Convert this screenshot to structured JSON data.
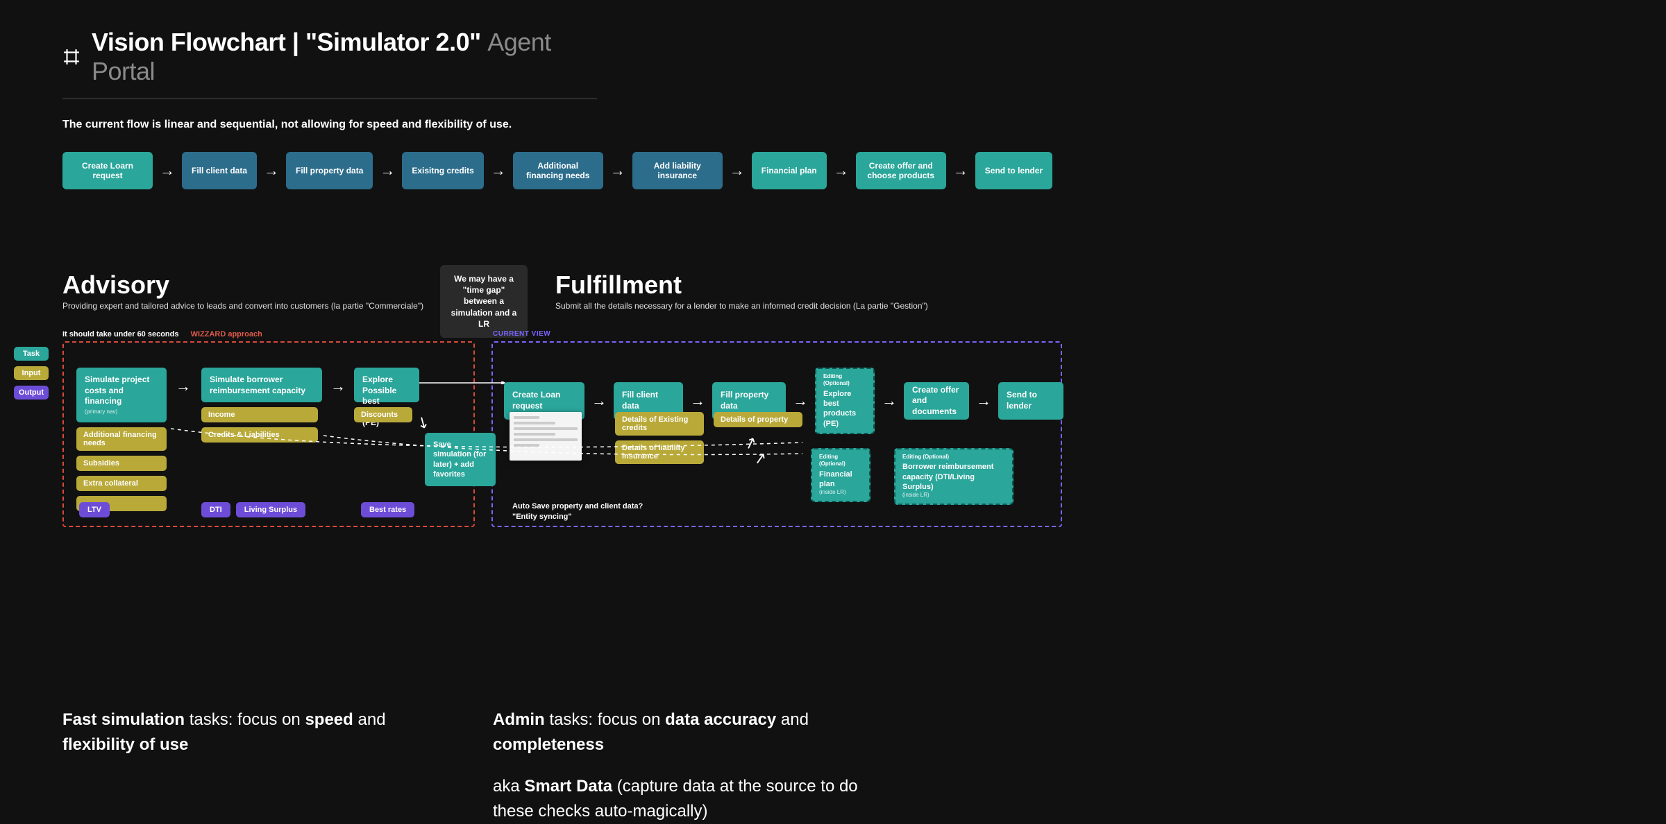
{
  "header": {
    "title_main": "Vision Flowchart | \"Simulator 2.0\"",
    "title_sub": "Agent Portal"
  },
  "intro": "The current flow is linear and sequential, not allowing for speed and flexibility of use.",
  "linear_flow": [
    {
      "label": "Create Loarn request",
      "type": "teal"
    },
    {
      "label": "Fill client data",
      "type": "blue"
    },
    {
      "label": "Fill property data",
      "type": "blue"
    },
    {
      "label": "Exisitng credits",
      "type": "blue"
    },
    {
      "label": "Additional financing needs",
      "type": "blue"
    },
    {
      "label": "Add liability insurance",
      "type": "blue"
    },
    {
      "label": "Financial plan",
      "type": "teal"
    },
    {
      "label": "Create offer and choose products",
      "type": "teal"
    },
    {
      "label": "Send to lender",
      "type": "teal"
    }
  ],
  "advisory": {
    "heading": "Advisory",
    "desc": "Providing expert and tailored advice to leads and convert into customers (la partie \"Commerciale\")",
    "hint": "it should take under 60 seconds",
    "wizzard": "WIZZARD approach"
  },
  "gap_note": "We may have a \"time gap\" between a simulation and a LR",
  "fulfillment": {
    "heading": "Fulfillment",
    "desc": "Submit all the details necessary for a lender to make an informed credit decision (La partie \"Gestion\")",
    "current_view": "CURRENT VIEW"
  },
  "legend": {
    "task": "Task",
    "input": "Input",
    "output": "Output"
  },
  "adv_col1": {
    "task": "Simulate project costs and financing",
    "task_tiny": "(primary nav)",
    "inputs": [
      "Additional financing needs",
      "Subsidies",
      "Extra collateral",
      "…"
    ],
    "outputs": [
      "LTV"
    ]
  },
  "adv_col2": {
    "task": "Simulate borrower reimbursement capacity",
    "inputs": [
      "Income",
      "Credits & Liabilities"
    ],
    "outputs": [
      "DTI",
      "Living Surplus"
    ]
  },
  "adv_col3": {
    "task": "Explore Possible best products (PE)",
    "inputs": [
      "Discounts"
    ],
    "outputs": [
      "Best rates"
    ],
    "save_sim": "Save simulation (for later) + add favorites"
  },
  "ful": {
    "tasks": [
      "Create Loan request",
      "Fill client data",
      "Fill property data"
    ],
    "opt1": {
      "ed": "Editing (Optional)",
      "label": "Explore best products (PE)"
    },
    "tasks2": [
      "Create offer and documents",
      "Send to lender"
    ],
    "inputs_col2": [
      "Details of Existing credits",
      "Details of liability insurance"
    ],
    "inputs_col3": [
      "Details of property"
    ],
    "opt2": {
      "ed": "Editing  (Optional)",
      "label": "Financial plan",
      "tiny": "(inside LR)"
    },
    "opt3": {
      "ed": "Editing  (Optional)",
      "label": "Borrower reimbursement capacity (DTI/Living Surplus)",
      "tiny": "(inside LR)"
    },
    "auto_save": "Auto Save property and client data?\n\"Entity syncing\""
  },
  "bottom_left": {
    "b1": "Fast simulation",
    "t1": " tasks: focus on ",
    "b2": "speed",
    "t2": " and ",
    "b3": "flexibility of use"
  },
  "bottom_right": {
    "b1": "Admin",
    "t1": " tasks: focus on ",
    "b2": "data accuracy",
    "t2": " and ",
    "b3": "completeness",
    "line2_t1": "aka ",
    "line2_b1": "Smart Data",
    "line2_t2": " (capture data at the source to do these checks auto-magically)"
  }
}
